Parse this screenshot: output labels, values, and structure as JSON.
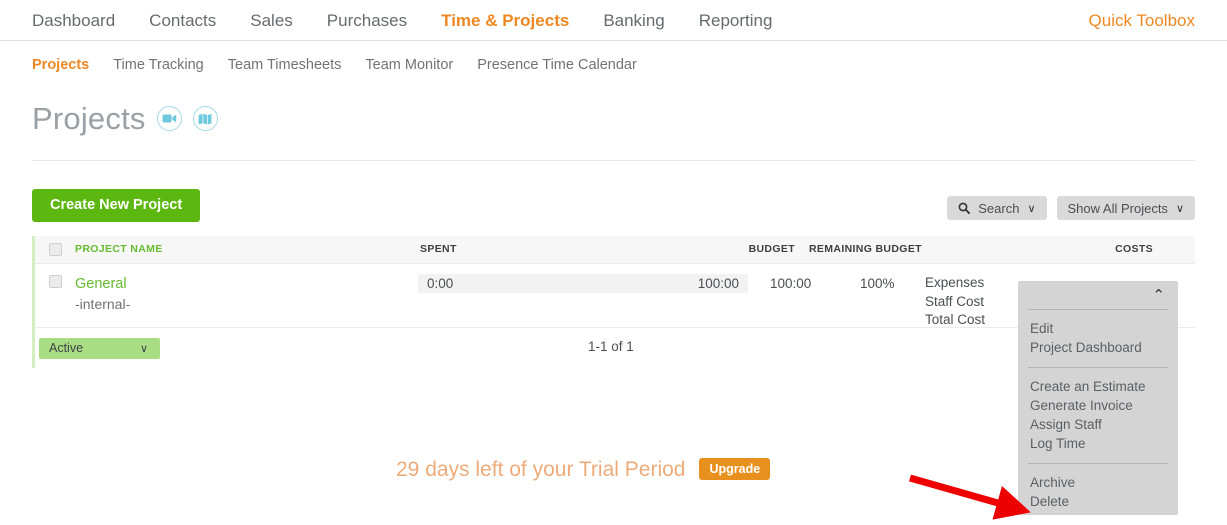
{
  "topnav": {
    "items": [
      {
        "label": "Dashboard",
        "active": false
      },
      {
        "label": "Contacts",
        "active": false
      },
      {
        "label": "Sales",
        "active": false
      },
      {
        "label": "Purchases",
        "active": false
      },
      {
        "label": "Time & Projects",
        "active": true
      },
      {
        "label": "Banking",
        "active": false
      },
      {
        "label": "Reporting",
        "active": false
      }
    ],
    "quick_toolbox": "Quick Toolbox"
  },
  "subnav": {
    "items": [
      {
        "label": "Projects",
        "active": true
      },
      {
        "label": "Time Tracking",
        "active": false
      },
      {
        "label": "Team Timesheets",
        "active": false
      },
      {
        "label": "Team Monitor",
        "active": false
      },
      {
        "label": "Presence Time Calendar",
        "active": false
      }
    ]
  },
  "header": {
    "title": "Projects",
    "video_icon": "video-camera-icon",
    "map_icon": "map-icon"
  },
  "toolbar": {
    "create_label": "Create New Project",
    "search_label": "Search",
    "search_icon": "search-icon",
    "filter_label": "Show All Projects",
    "chevron": "∨"
  },
  "table": {
    "columns": [
      {
        "key": "name",
        "label": "PROJECT NAME"
      },
      {
        "key": "spent",
        "label": "SPENT"
      },
      {
        "key": "budget",
        "label": "BUDGET"
      },
      {
        "key": "remaining",
        "label": "REMAINING BUDGET"
      },
      {
        "key": "costs",
        "label": "COSTS"
      }
    ],
    "row": {
      "name": "General",
      "subtitle": "-internal-",
      "spent": "0:00",
      "budget": "100:00",
      "remaining": "100:00",
      "percent": "100%",
      "costs": [
        "Expenses",
        "Staff Cost",
        "Total Cost"
      ]
    },
    "footer": {
      "status_filter": "Active",
      "status_chevron": "∨",
      "pagination": "1-1 of 1"
    }
  },
  "trial": {
    "message": "29 days left of your Trial Period",
    "upgrade_label": "Upgrade"
  },
  "dropdown": {
    "collapse_chevron": "⌃",
    "groups": [
      [
        "Edit",
        "Project Dashboard"
      ],
      [
        "Create an Estimate",
        "Generate Invoice",
        "Assign Staff",
        "Log Time"
      ],
      [
        "Archive",
        "Delete"
      ]
    ]
  },
  "annotation": {
    "arrow_color": "#ee0000",
    "arrow_target": "Delete"
  },
  "colors": {
    "accent_orange": "#ef8822",
    "green": "#5cb811",
    "link_green": "#66bb2e",
    "icon_blue": "#a8dbe8",
    "upgrade_orange": "#e8901e"
  }
}
